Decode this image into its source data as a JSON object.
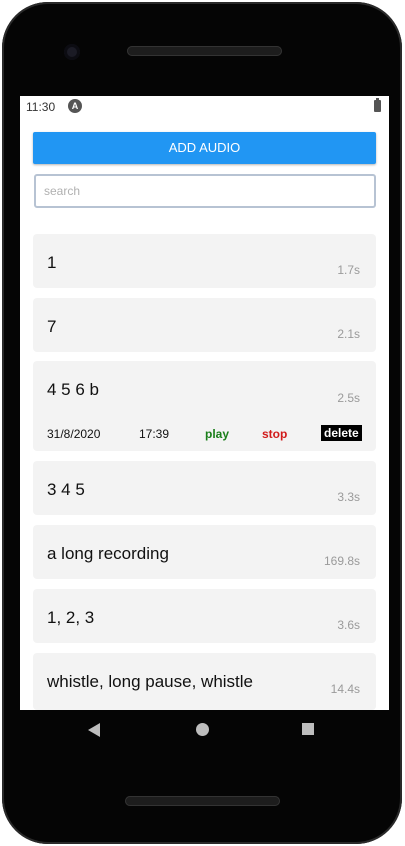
{
  "status_bar": {
    "time": "11:30",
    "app_badge": "A"
  },
  "header": {
    "add_button_label": "ADD AUDIO"
  },
  "search": {
    "placeholder": "search",
    "value": ""
  },
  "recordings": [
    {
      "title": "1",
      "duration": "1.7s"
    },
    {
      "title": "7",
      "duration": "2.1s"
    },
    {
      "title": "4 5 6 b",
      "duration": "2.5s",
      "expanded": true,
      "date": "31/8/2020",
      "time": "17:39",
      "play_label": "play",
      "stop_label": "stop",
      "delete_label": "delete"
    },
    {
      "title": "3 4 5",
      "duration": "3.3s"
    },
    {
      "title": "a long recording",
      "duration": "169.8s"
    },
    {
      "title": "1, 2, 3",
      "duration": "3.6s"
    },
    {
      "title": "whistle, long pause, whistle",
      "duration": "14.4s"
    }
  ],
  "colors": {
    "accent": "#2196f3",
    "play": "#1a7f1a",
    "stop": "#d11b1b",
    "card_bg": "#f3f3f3"
  }
}
